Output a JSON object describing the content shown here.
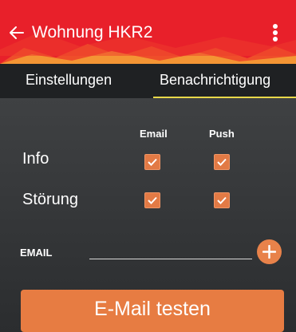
{
  "appbar": {
    "title": "Wohnung HKR2",
    "back_icon": "arrow-left-icon",
    "menu_icon": "more-vertical-icon",
    "color": "#e8202a"
  },
  "tabs": [
    {
      "label": "Einstellungen",
      "active": false
    },
    {
      "label": "Benachrichtigung",
      "active": true
    }
  ],
  "notifications": {
    "columns": [
      "Email",
      "Push"
    ],
    "rows": [
      {
        "label": "Info",
        "email": true,
        "push": true
      },
      {
        "label": "Störung",
        "email": true,
        "push": true
      }
    ]
  },
  "email": {
    "label": "EMAIL",
    "value": "",
    "add_icon": "plus-icon"
  },
  "actions": {
    "test_label": "E-Mail testen"
  },
  "colors": {
    "accent": "#e77c42",
    "tab_indicator": "#e8d84a"
  }
}
